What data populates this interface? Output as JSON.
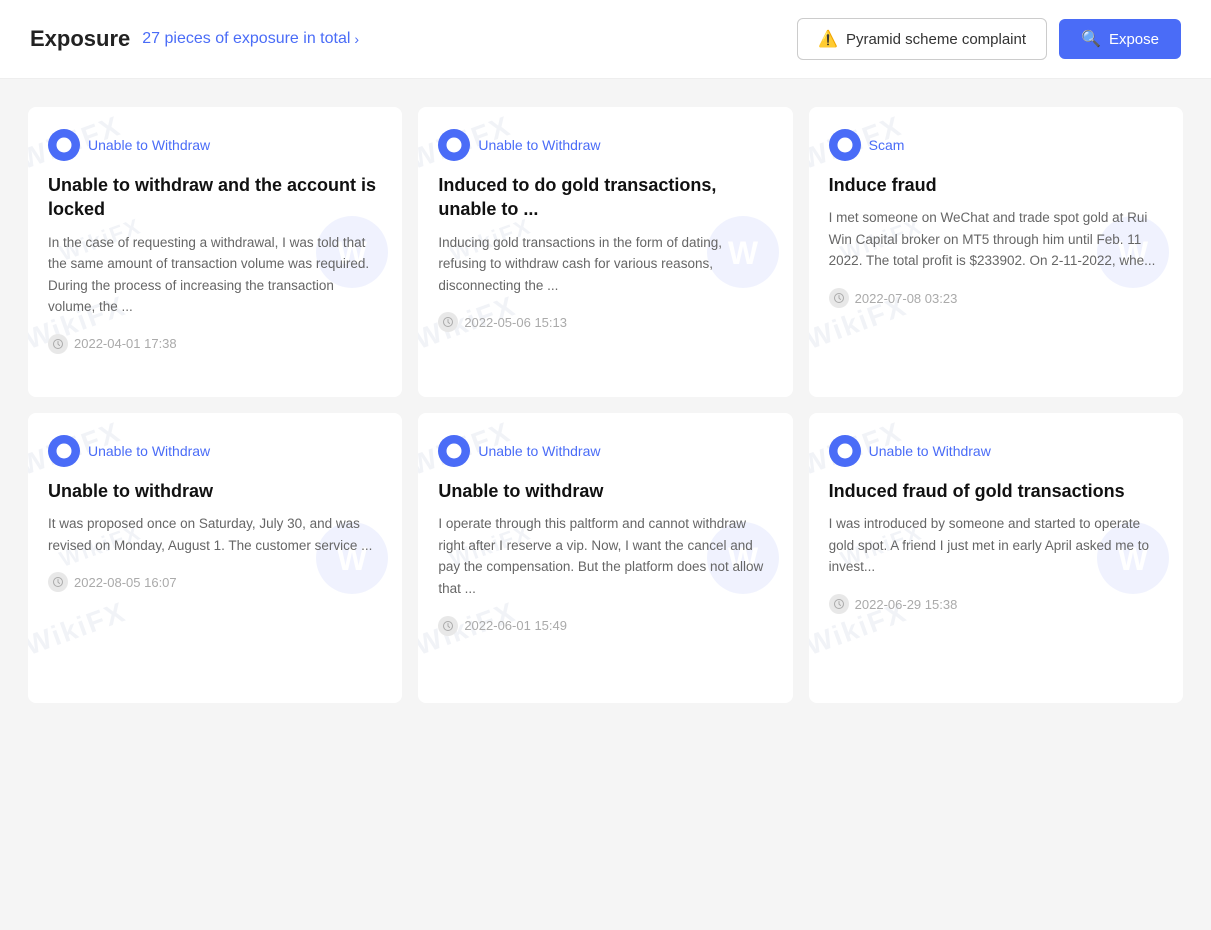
{
  "header": {
    "title": "Exposure",
    "count_label": "27 pieces of exposure in total",
    "pyramid_btn": "Pyramid scheme complaint",
    "expose_btn": "Expose"
  },
  "cards": [
    {
      "tag": "Unable to Withdraw",
      "tag_type": "withdraw",
      "title": "Unable to withdraw and the account is locked",
      "desc": "In the case of requesting a withdrawal, I was told that the same amount of transaction volume was required. During the process of increasing the transaction volume, the ...",
      "time": "2022-04-01 17:38"
    },
    {
      "tag": "Unable to Withdraw",
      "tag_type": "withdraw",
      "title": "Induced to do gold transactions, unable to ...",
      "desc": "Inducing gold transactions in the form of dating, refusing to withdraw cash for various reasons, disconnecting the ...",
      "time": "2022-05-06 15:13"
    },
    {
      "tag": "Scam",
      "tag_type": "scam",
      "title": "Induce fraud",
      "desc": "I met someone on WeChat and trade spot gold at Rui Win Capital broker on MT5 through him until Feb. 11 2022. The total profit is $233902. On 2-11-2022, whe...",
      "time": "2022-07-08 03:23"
    },
    {
      "tag": "Unable to Withdraw",
      "tag_type": "withdraw",
      "title": "Unable to withdraw",
      "desc": "It was proposed once on Saturday, July 30, and was revised on Monday, August 1. The customer service ...",
      "time": "2022-08-05 16:07"
    },
    {
      "tag": "Unable to Withdraw",
      "tag_type": "withdraw",
      "title": "Unable to withdraw",
      "desc": "I operate through this paltform and cannot withdraw right after I reserve a vip. Now, I want the cancel and pay the compensation. But the platform does not allow that ...",
      "time": "2022-06-01 15:49"
    },
    {
      "tag": "Unable to Withdraw",
      "tag_type": "withdraw",
      "title": "Induced fraud of gold transactions",
      "desc": "I was introduced by someone and started to operate gold spot. A friend I just met in early April asked me to invest...",
      "time": "2022-06-29 15:38"
    }
  ]
}
